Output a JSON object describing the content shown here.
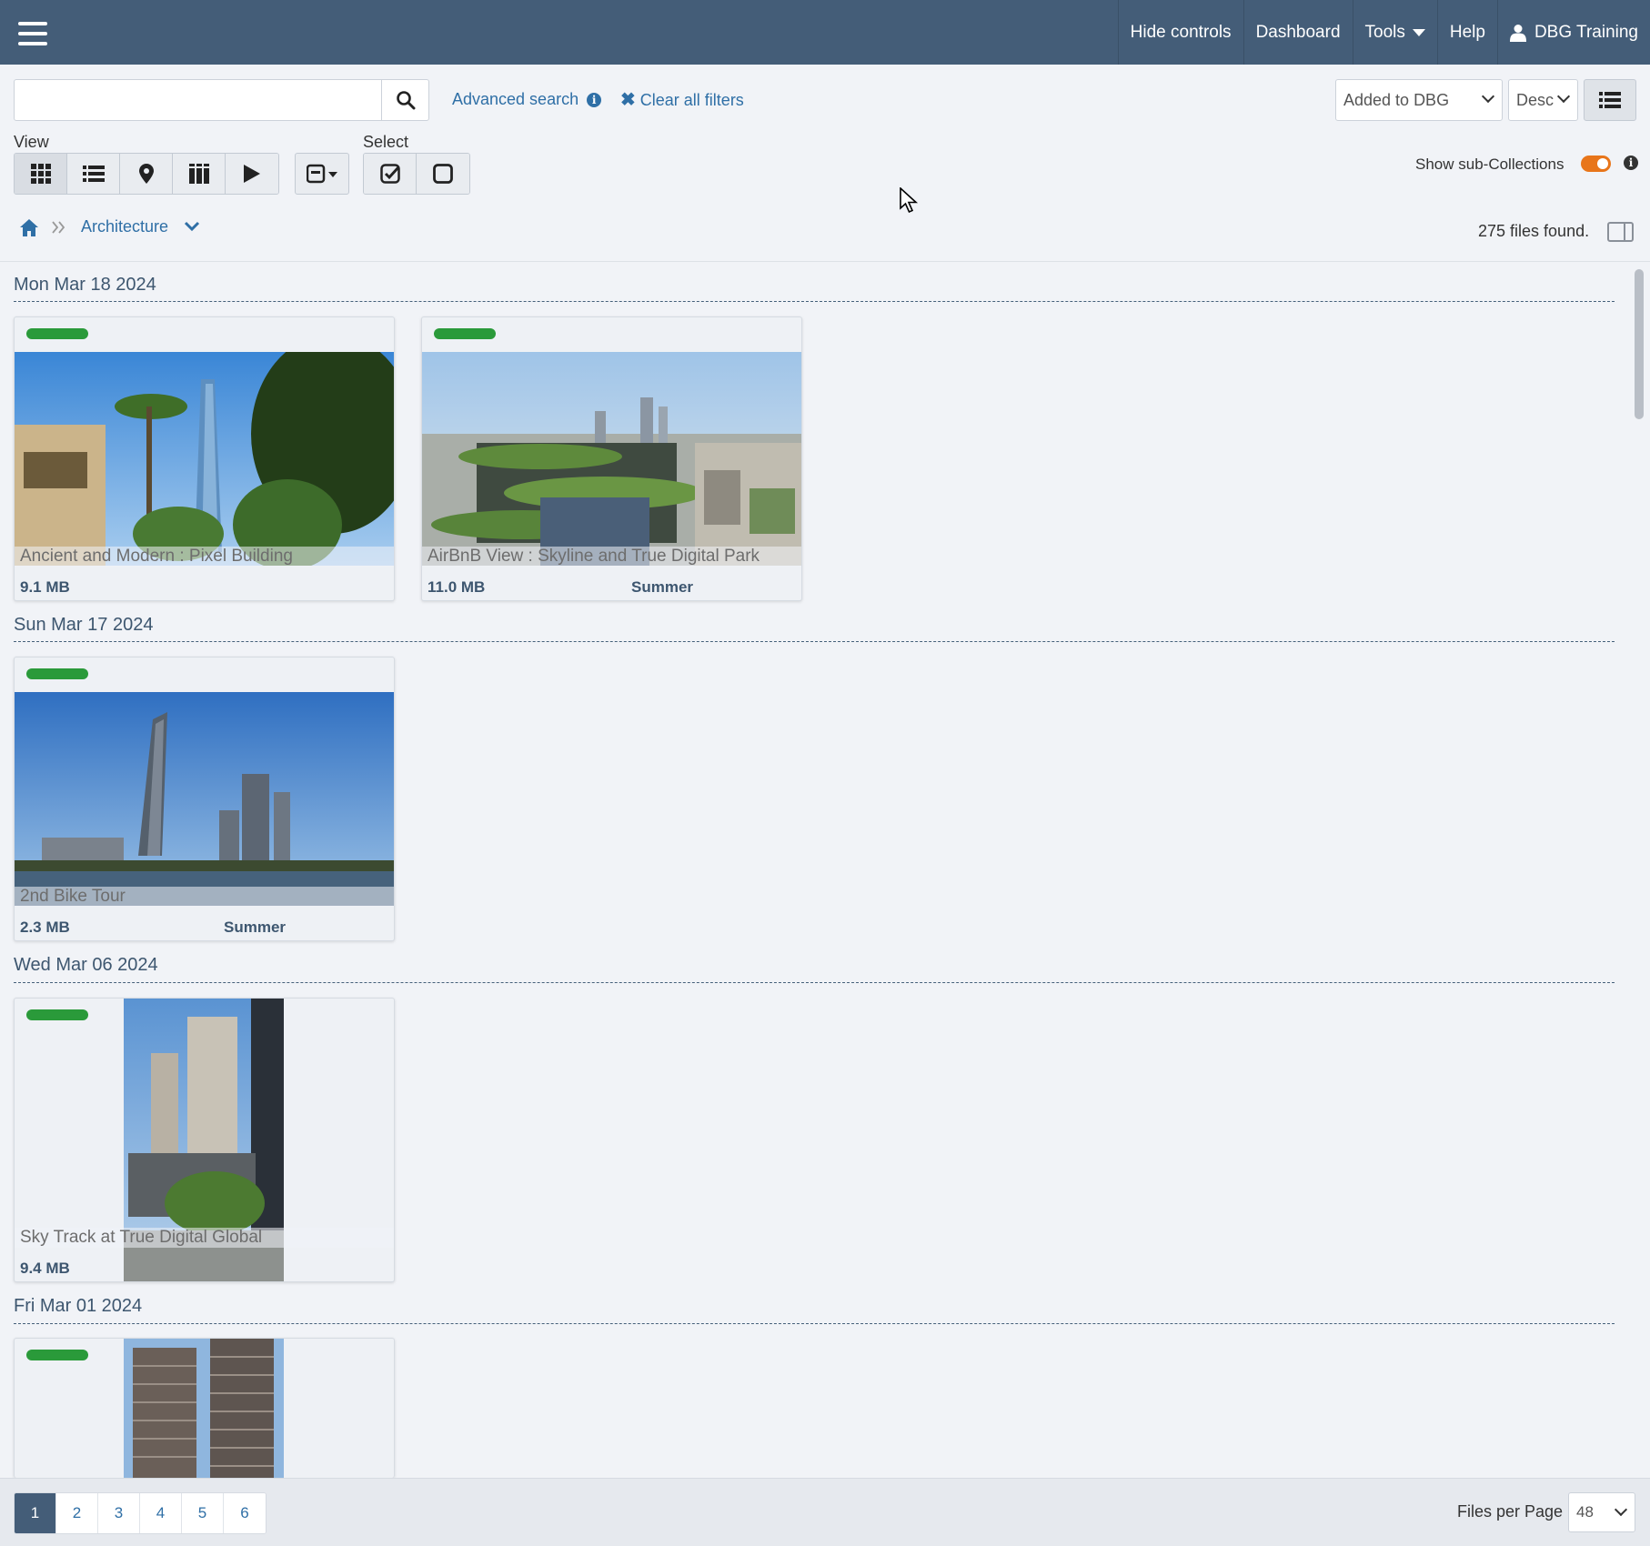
{
  "nav": {
    "hide_controls": "Hide controls",
    "dashboard": "Dashboard",
    "tools": "Tools",
    "help": "Help",
    "user": "DBG Training"
  },
  "search": {
    "value": "",
    "placeholder": "",
    "advanced_search": "Advanced search",
    "clear_filters": "Clear all filters"
  },
  "sort": {
    "field": "Added to DBG",
    "order": "Desc"
  },
  "toolbar": {
    "view_label": "View",
    "select_label": "Select",
    "sub_collections_label": "Show sub-Collections",
    "sub_collections_on": true
  },
  "breadcrumb": {
    "current": "Architecture"
  },
  "results": {
    "count_text": "275 files found."
  },
  "groups": [
    {
      "date": "Mon Mar 18 2024",
      "items": [
        {
          "title": "Ancient and Modern : Pixel Building",
          "size": "9.1 MB",
          "season": ""
        },
        {
          "title": "AirBnB View : Skyline and True Digital Park",
          "size": "11.0 MB",
          "season": "Summer"
        }
      ]
    },
    {
      "date": "Sun Mar 17 2024",
      "items": [
        {
          "title": "2nd Bike Tour",
          "size": "2.3 MB",
          "season": "Summer"
        }
      ]
    },
    {
      "date": "Wed Mar 06 2024",
      "items": [
        {
          "title": "Sky Track at True Digital Global",
          "size": "9.4 MB",
          "season": ""
        }
      ]
    },
    {
      "date": "Fri Mar 01 2024",
      "items": []
    }
  ],
  "pagination": {
    "pages": [
      "1",
      "2",
      "3",
      "4",
      "5",
      "6"
    ],
    "current": "1",
    "per_page_label": "Files per Page",
    "per_page": "48"
  },
  "colors": {
    "topbar": "#445d78",
    "accent_link": "#2f6fa6",
    "status_badge": "#2a9a3a",
    "toggle_on": "#e8751a"
  }
}
